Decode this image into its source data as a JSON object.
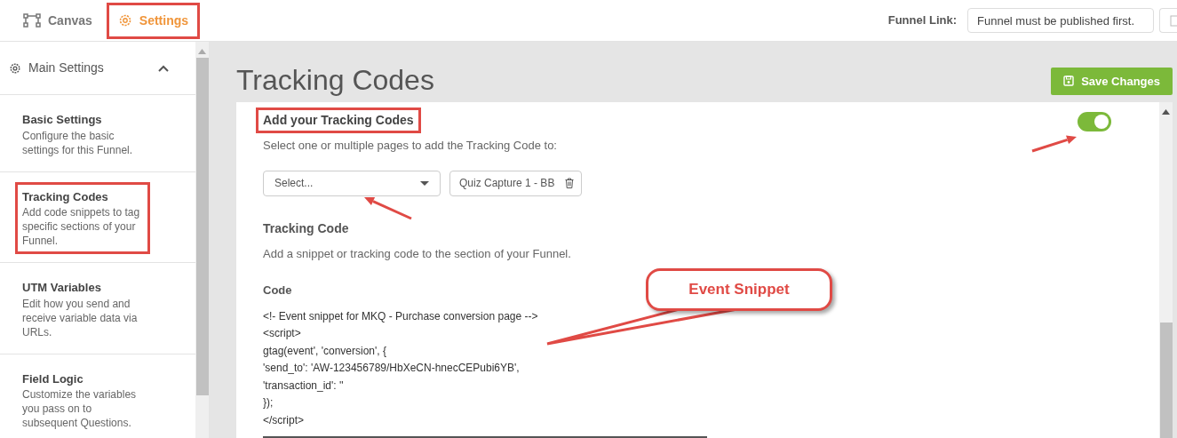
{
  "top_nav": {
    "tabs": [
      {
        "label": "Canvas",
        "kind": "canvas",
        "selected": false,
        "highlighted": false
      },
      {
        "label": "Settings",
        "kind": "settings",
        "selected": true,
        "highlighted": true
      }
    ],
    "funnel_link": {
      "label": "Funnel Link:",
      "value": "Funnel must be published first."
    }
  },
  "sidebar": {
    "section": {
      "title": "Main Settings",
      "expanded": true
    },
    "items": [
      {
        "title": "Basic Settings",
        "description": "Configure the basic settings for this Funnel.",
        "highlighted": false
      },
      {
        "title": "Tracking Codes",
        "description": "Add code snippets to tag specific sections of your Funnel.",
        "highlighted": true
      },
      {
        "title": "UTM Variables",
        "description": "Edit how you send and receive variable data via URLs.",
        "highlighted": false
      },
      {
        "title": "Field Logic",
        "description": "Customize the variables you pass on to subsequent Questions.",
        "highlighted": false
      }
    ]
  },
  "main": {
    "title": "Tracking Codes",
    "save_button": "Save Changes",
    "panel": {
      "heading": "Add your Tracking Codes",
      "heading_highlighted": true,
      "enabled": true,
      "instruction": "Select one or multiple pages to add the Tracking Code to:",
      "select": {
        "placeholder": "Select..."
      },
      "selected_pages": [
        "Quiz Capture 1 - BB"
      ],
      "tracking_heading": "Tracking Code",
      "tracking_description": "Add a snippet or tracking code to the section of your Funnel.",
      "code_label": "Code",
      "code_lines": [
        "<!- Event snippet for MKQ - Purchase conversion page -->",
        "<script>",
        "gtag(event', 'conversion', {",
        "'send_to': 'AW-123456789/HbXeCN-hnecCEPubi6YB',",
        "'transaction_id': ''",
        "});",
        "</script>"
      ]
    }
  },
  "annotations": {
    "callout": "Event Snippet"
  }
}
